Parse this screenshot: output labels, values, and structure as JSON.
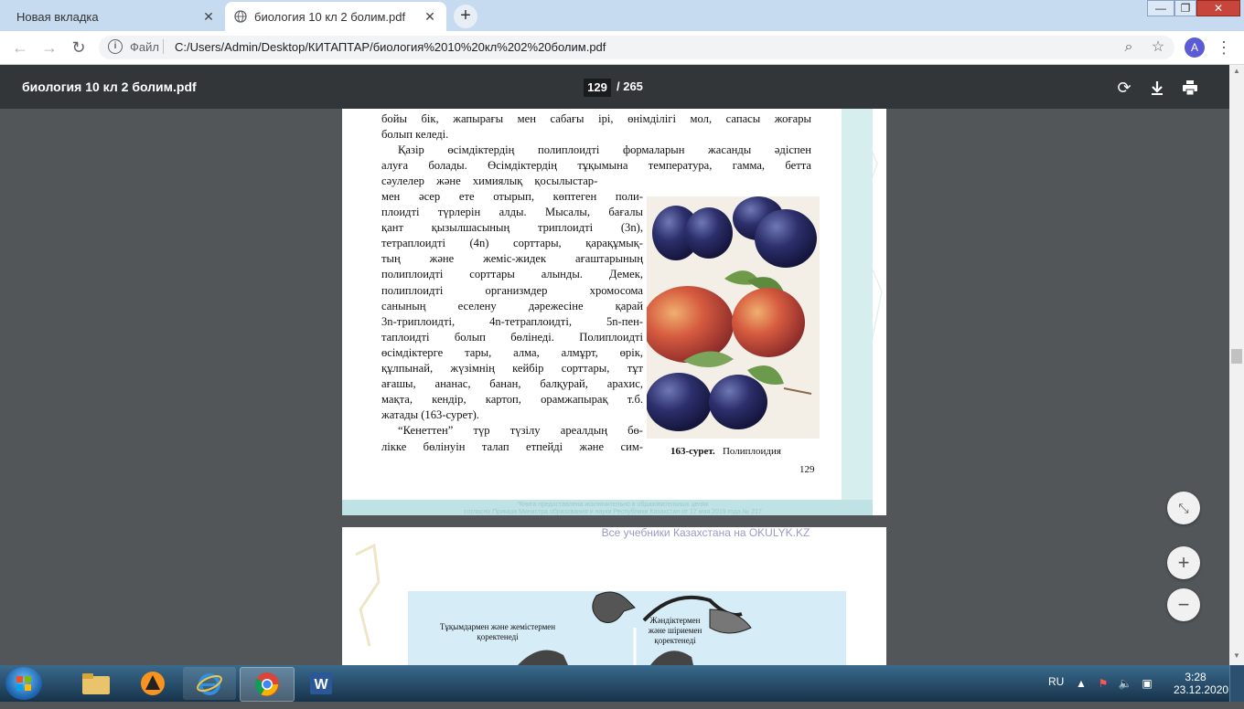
{
  "browser": {
    "tabs": [
      {
        "label": "Новая вкладка",
        "active": false
      },
      {
        "label": "биология 10 кл 2 болим.pdf",
        "active": true
      }
    ],
    "new_tab_icon": "+",
    "omnibox": {
      "scheme_label": "Файл",
      "url": "C:/Users/Admin/Desktop/КИТАПТАР/биология%2010%20кл%202%20болим.pdf"
    },
    "profile_initial": "A"
  },
  "pdf": {
    "title": "биология 10 кл 2 болим.pdf",
    "current_page": "129",
    "total_pages": "/ 265",
    "page1": {
      "para1": [
        "бойы бік, жапырағы мен сабағы ірі, өнімділігі мол, сапасы жоғары",
        "болып келеді."
      ],
      "para2_full": [
        "Қазір өсімдіктердің полиплоидті формаларын жасанды әдіспен",
        "алуға болады. Өсімдіктердің тұқымына температура, гамма, бетта",
        "сәулелер және химиялық қосылыстар-"
      ],
      "para2_narrow": [
        "мен әсер ете отырып, көптеген поли-",
        "плоидті түрлерін алды. Мысалы, бағалы",
        "қант қызылшасының триплоидті (3n),",
        "тетраплоидті (4n) сорттары, қарақұмық-",
        "тың және жеміс-жидек ағаштарының",
        "полиплоидті сорттары алынды. Демек,",
        "полиплоидті организмдер хромосома",
        "санының еселену дәрежесіне қарай",
        "3n-триплоидті, 4n-тетраплоидті, 5n-пен-",
        "таплоидті болып бөлінеді. Полиплоидті",
        "өсімдіктерге тары, алма, алмұрт, өрік,",
        "құлпынай, жүзімнің кейбір сорттары, тұт",
        "ағашы, ананас, банан, балқурай, арахис,",
        "мақта, кендір, картоп, орамжапырақ т.б.",
        "жатады (163-сурет).",
        "“Кенеттен” түр түзілу ареалдың бө-",
        "лікке бөлінуін талап етпейді және сим-"
      ],
      "caption_num": "163-сурет.",
      "caption_text": "Полиплоидия",
      "printed_page_number": "129",
      "watermark": [
        "\"Книга предоставлена исключительно в образовательных целях",
        "согласно Приказа Министра образования и науки Республики Казахстан от 17 мая 2019 года № 217"
      ]
    },
    "between_pages_label": "Все учебники Казахстана на OKULYK.KZ",
    "page2": {
      "label_left": [
        "Тұқымдармен және жемістермен",
        "қоректенеді"
      ],
      "label_right": [
        "Жәндіктермен",
        "және шіриемен",
        "қоректенеді"
      ]
    }
  },
  "taskbar": {
    "apps": [
      "explorer",
      "avast",
      "internet-explorer",
      "chrome",
      "word"
    ],
    "language": "RU",
    "time": "3:28",
    "date": "23.12.2020"
  }
}
